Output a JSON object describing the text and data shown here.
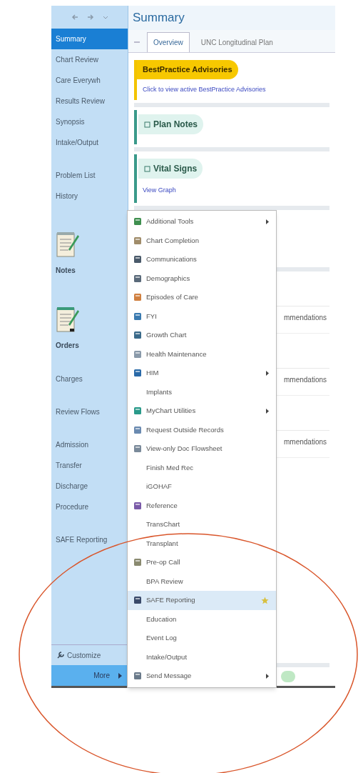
{
  "sidebar": {
    "groups": [
      [
        {
          "label": "Summary",
          "kind": "item",
          "selected": true
        },
        {
          "label": "Chart Review",
          "kind": "item",
          "selected": false
        },
        {
          "label": "Care Everywh",
          "kind": "item",
          "selected": false
        },
        {
          "label": "Results Review",
          "kind": "item",
          "selected": false
        },
        {
          "label": "Synopsis",
          "kind": "item",
          "selected": false
        },
        {
          "label": "Intake/Output",
          "kind": "item",
          "selected": false
        }
      ],
      [
        {
          "label": "Problem List",
          "kind": "item",
          "selected": false
        },
        {
          "label": "History",
          "kind": "item",
          "selected": false
        }
      ],
      [
        {
          "label": "Notes",
          "kind": "big",
          "selected": false
        }
      ],
      [
        {
          "label": "Orders",
          "kind": "big",
          "selected": false
        }
      ],
      [
        {
          "label": "Charges",
          "kind": "item",
          "selected": false
        }
      ],
      [
        {
          "label": "Review Flows",
          "kind": "item",
          "selected": false
        }
      ],
      [
        {
          "label": "Admission",
          "kind": "item",
          "selected": false
        },
        {
          "label": "Transfer",
          "kind": "item",
          "selected": false
        },
        {
          "label": "Discharge",
          "kind": "item",
          "selected": false
        },
        {
          "label": "Procedure",
          "kind": "item",
          "selected": false
        }
      ],
      [
        {
          "label": "SAFE Reporting",
          "kind": "item",
          "selected": false
        }
      ]
    ],
    "customize": "Customize",
    "more": "More"
  },
  "content": {
    "title": "Summary",
    "tabs": [
      {
        "label": "Overview",
        "selected": true
      },
      {
        "label": "UNC Longitudinal Plan",
        "selected": false
      }
    ],
    "advisory": {
      "title": "BestPractice Advisories",
      "link": "Click to view active BestPractice Advisories"
    },
    "sections": [
      {
        "title": "Plan Notes"
      },
      {
        "title": "Vital Signs",
        "link": "View Graph"
      }
    ],
    "hidden_rows": [
      "mmendations",
      "mmendations",
      "mmendations"
    ]
  },
  "menu": {
    "items": [
      {
        "label": "Additional Tools",
        "icon": true,
        "submenu": true,
        "highlighted": false,
        "starred": false
      },
      {
        "label": "Chart Completion",
        "icon": true,
        "submenu": false,
        "highlighted": false,
        "starred": false
      },
      {
        "label": "Communications",
        "icon": true,
        "submenu": false,
        "highlighted": false,
        "starred": false
      },
      {
        "label": "Demographics",
        "icon": true,
        "submenu": false,
        "highlighted": false,
        "starred": false
      },
      {
        "label": "Episodes of Care",
        "icon": true,
        "submenu": false,
        "highlighted": false,
        "starred": false
      },
      {
        "label": "FYI",
        "icon": true,
        "submenu": false,
        "highlighted": false,
        "starred": false
      },
      {
        "label": "Growth Chart",
        "icon": true,
        "submenu": false,
        "highlighted": false,
        "starred": false
      },
      {
        "label": "Health Maintenance",
        "icon": true,
        "submenu": false,
        "highlighted": false,
        "starred": false
      },
      {
        "label": "HIM",
        "icon": true,
        "submenu": true,
        "highlighted": false,
        "starred": false
      },
      {
        "label": "Implants",
        "icon": false,
        "submenu": false,
        "highlighted": false,
        "starred": false
      },
      {
        "label": "MyChart Utilities",
        "icon": true,
        "submenu": true,
        "highlighted": false,
        "starred": false
      },
      {
        "label": "Request Outside Records",
        "icon": true,
        "submenu": false,
        "highlighted": false,
        "starred": false
      },
      {
        "label": "View-only Doc Flowsheet",
        "icon": true,
        "submenu": false,
        "highlighted": false,
        "starred": false
      },
      {
        "label": "Finish Med Rec",
        "icon": false,
        "submenu": false,
        "highlighted": false,
        "starred": false
      },
      {
        "label": "iGOHAF",
        "icon": false,
        "submenu": false,
        "highlighted": false,
        "starred": false
      },
      {
        "label": "Reference",
        "icon": true,
        "submenu": false,
        "highlighted": false,
        "starred": false
      },
      {
        "label": "TransChart",
        "icon": false,
        "submenu": false,
        "highlighted": false,
        "starred": false
      },
      {
        "label": "Transplant",
        "icon": false,
        "submenu": false,
        "highlighted": false,
        "starred": false
      },
      {
        "label": "Pre-op Call",
        "icon": true,
        "submenu": false,
        "highlighted": false,
        "starred": false
      },
      {
        "label": "BPA Review",
        "icon": false,
        "submenu": false,
        "highlighted": false,
        "starred": false
      },
      {
        "label": "SAFE Reporting",
        "icon": true,
        "submenu": false,
        "highlighted": true,
        "starred": true
      },
      {
        "label": "Education",
        "icon": false,
        "submenu": false,
        "highlighted": false,
        "starred": false
      },
      {
        "label": "Event Log",
        "icon": false,
        "submenu": false,
        "highlighted": false,
        "starred": false
      },
      {
        "label": "Intake/Output",
        "icon": false,
        "submenu": false,
        "highlighted": false,
        "starred": false
      },
      {
        "label": "Send Message",
        "icon": true,
        "submenu": true,
        "highlighted": false,
        "starred": false
      }
    ]
  }
}
